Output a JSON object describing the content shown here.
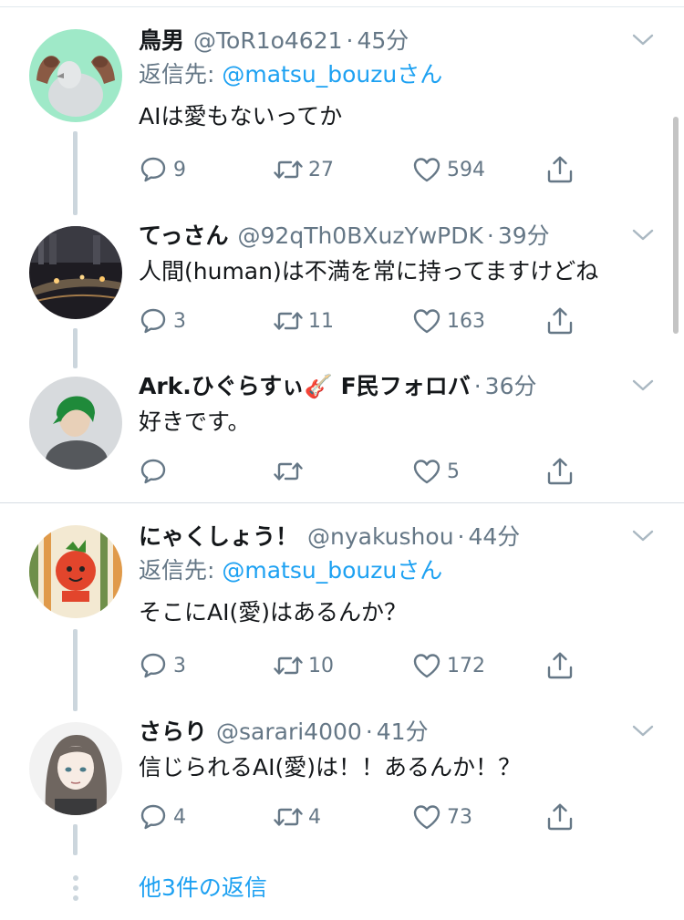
{
  "tweets": [
    {
      "name": "鳥男",
      "handle": "@ToR1o4621",
      "time": "45分",
      "reply_prefix": "返信先: ",
      "reply_mention": "@matsu_bouzu",
      "reply_suffix": "さん",
      "text": "AIは愛もないってか",
      "replies": "9",
      "retweets": "27",
      "likes": "594"
    },
    {
      "name": "てっさん",
      "handle": "@92qTh0BXuzYwPDK",
      "time": "39分",
      "text": "人間(human)は不満を常に持ってますけどね",
      "replies": "3",
      "retweets": "11",
      "likes": "163"
    },
    {
      "name": "Ark.ひぐらすぃ🎸 F民フォロバ",
      "time": "36分",
      "text": "好きです。",
      "likes": "5"
    },
    {
      "name": "にゃくしょう！",
      "handle": "@nyakushou",
      "time": "44分",
      "reply_prefix": "返信先: ",
      "reply_mention": "@matsu_bouzu",
      "reply_suffix": "さん",
      "text": "そこにAI(愛)はあるんか？",
      "replies": "3",
      "retweets": "10",
      "likes": "172"
    },
    {
      "name": "さらり",
      "handle": "@sarari4000",
      "time": "41分",
      "text": "信じられるAI(愛)は！！あるんか！？",
      "replies": "4",
      "retweets": "4",
      "likes": "73"
    }
  ],
  "separator": "·",
  "more_replies": "他3件の返信",
  "colors": {
    "accent": "#1da1f2",
    "secondary_text": "#657786",
    "thread_line": "#ccd6dd"
  },
  "icons": {
    "reply": "reply-icon",
    "retweet": "retweet-icon",
    "like": "heart-icon",
    "share": "share-icon",
    "menu": "chevron-down-icon"
  }
}
